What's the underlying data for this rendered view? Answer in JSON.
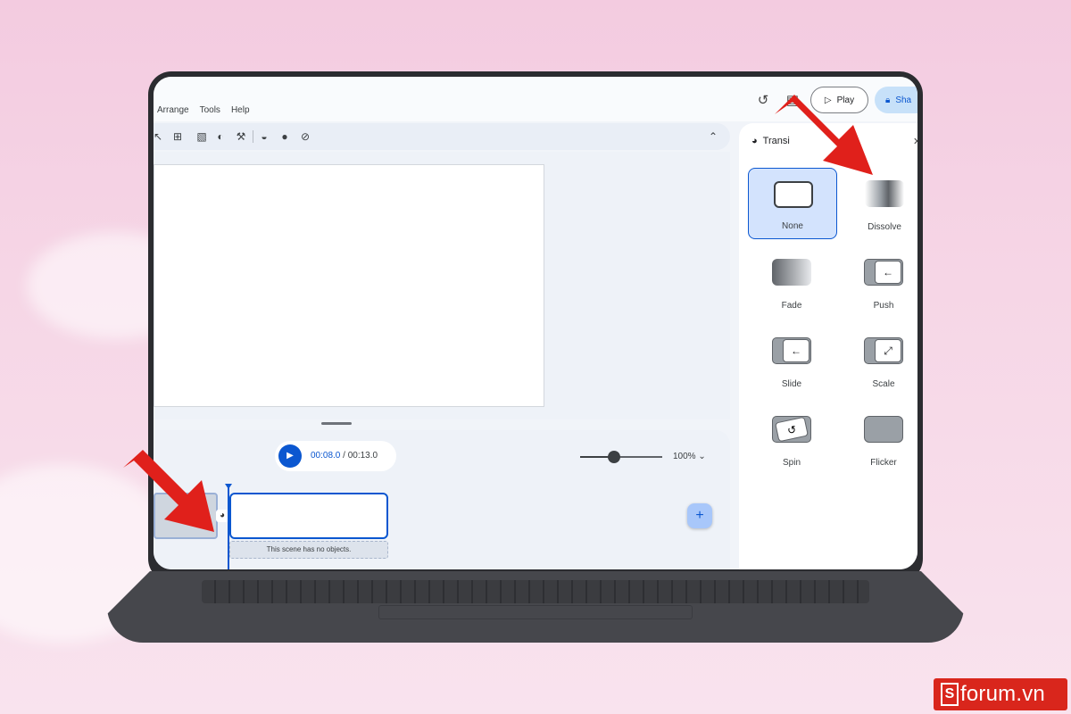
{
  "menu": {
    "items": [
      "Arrange",
      "Tools",
      "Help"
    ]
  },
  "header": {
    "play_label": "Play",
    "share_label": "Sha"
  },
  "timeline": {
    "current_time": "00:08.0",
    "separator": " / ",
    "total_time": "00:13.0",
    "zoom_level": "100%",
    "empty_scene_text": "This scene has no objects."
  },
  "transitions_panel": {
    "title": "Transi",
    "options": [
      {
        "label": "None",
        "selected": true
      },
      {
        "label": "Dissolve",
        "selected": false
      },
      {
        "label": "Fade",
        "selected": false
      },
      {
        "label": "Push",
        "selected": false
      },
      {
        "label": "Slide",
        "selected": false
      },
      {
        "label": "Scale",
        "selected": false
      },
      {
        "label": "Spin",
        "selected": false
      },
      {
        "label": "Flicker",
        "selected": false
      }
    ]
  },
  "colors": {
    "accent": "#0b57d0",
    "selected_bg": "#d3e3fd",
    "arrow": "#e0201b",
    "watermark": "#d9261c"
  },
  "watermark": {
    "letter": "S",
    "text": "forum.vn"
  }
}
